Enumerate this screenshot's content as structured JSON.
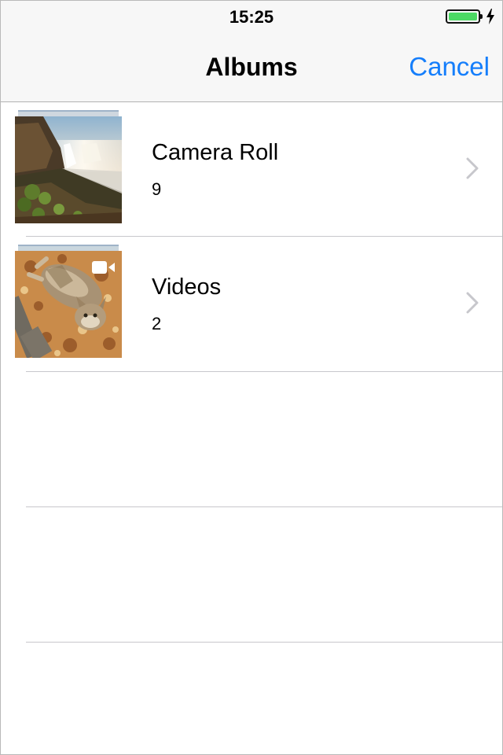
{
  "status_bar": {
    "time": "15:25",
    "battery_color": "#4cd964",
    "charging_icon": "bolt-icon"
  },
  "nav": {
    "title": "Albums",
    "cancel_label": "Cancel",
    "accent_color": "#157efb"
  },
  "albums": [
    {
      "title": "Camera Roll",
      "count": "9",
      "thumbnail": "waterfall-landscape-photo",
      "chevron_icon": "chevron-right-icon"
    },
    {
      "title": "Videos",
      "count": "2",
      "thumbnail": "cat-on-rug-photo",
      "badge_icon": "video-camera-icon",
      "chevron_icon": "chevron-right-icon"
    }
  ]
}
